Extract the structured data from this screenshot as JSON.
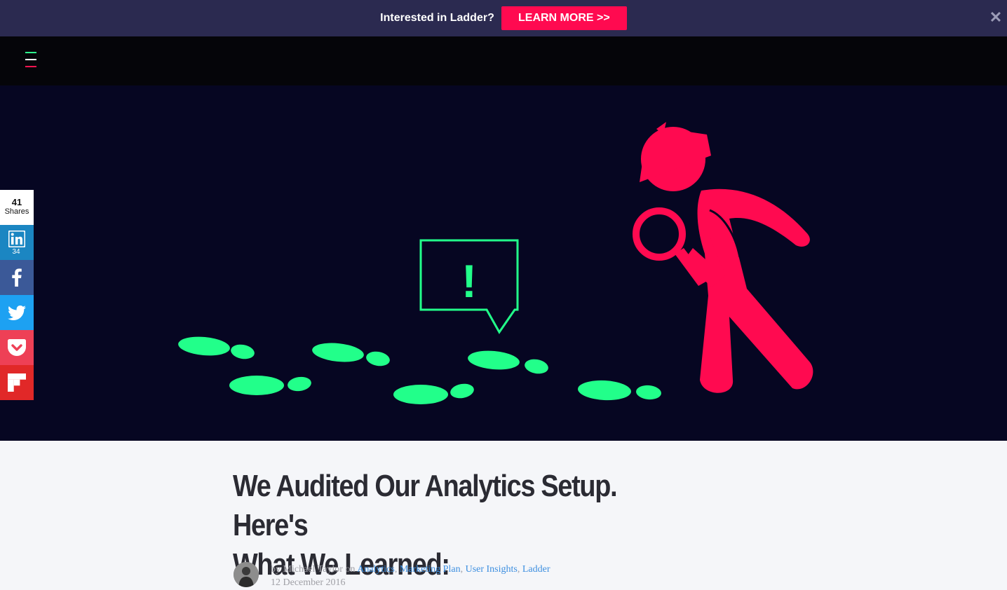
{
  "promo": {
    "text": "Interested in Ladder?",
    "button_label": "LEARN MORE >>",
    "close_glyph": "✕"
  },
  "nav": {
    "menu_icon": "hamburger-menu-icon",
    "menu_colors": [
      "#2eff8c",
      "#ffffff",
      "#ff1450"
    ]
  },
  "hero": {
    "exclamation": "!",
    "colors": {
      "background": "#060622",
      "figure": "#ff0a50",
      "footprints": "#22ff8a"
    }
  },
  "share": {
    "count": "41",
    "count_label": "Shares",
    "buttons": [
      {
        "network": "linkedin",
        "icon": "linkedin-icon",
        "count": "34",
        "color": "#1b86c2"
      },
      {
        "network": "facebook",
        "icon": "facebook-icon",
        "color": "#3b5998"
      },
      {
        "network": "twitter",
        "icon": "twitter-icon",
        "color": "#1da1f2"
      },
      {
        "network": "pocket",
        "icon": "pocket-icon",
        "color": "#ee4056"
      },
      {
        "network": "flipboard",
        "icon": "flipboard-icon",
        "color": "#e12828"
      }
    ]
  },
  "article": {
    "title_line1": "We Audited Our Analytics Setup. Here's",
    "title_line2": "What We Learned:",
    "by": "by",
    "author": "Michael Taylor",
    "on": "on",
    "categories": [
      "Analytics",
      "Marketing Plan",
      "User Insights",
      "Ladder"
    ],
    "date": "12 December 2016"
  }
}
